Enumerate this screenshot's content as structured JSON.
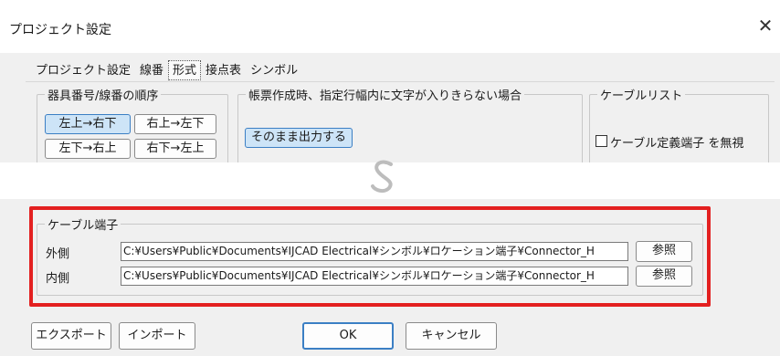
{
  "window": {
    "title": "プロジェクト設定",
    "close_glyph": "✕"
  },
  "tabs": [
    "プロジェクト設定",
    "線番",
    "形式",
    "接点表",
    "シンボル"
  ],
  "active_tab": "形式",
  "order_group": {
    "legend": "器具番号/線番の順序",
    "buttons": [
      "左上→右下",
      "右上→左下",
      "左下→右上",
      "右下→左上"
    ],
    "selected": "左上→右下"
  },
  "overflow_group": {
    "legend": "帳票作成時、指定行幅内に文字が入りきらない場合",
    "button": "そのまま出力する"
  },
  "cable_list_group": {
    "legend": "ケーブルリスト",
    "checkbox_label": "ケーブル定義端子 を無視",
    "checked": false
  },
  "cable_terminal_group": {
    "legend": "ケーブル端子",
    "outer_label": "外側",
    "outer_path": "C:¥Users¥Public¥Documents¥IJCAD Electrical¥シンボル¥ロケーション端子¥Connector_H",
    "inner_label": "内側",
    "inner_path": "C:¥Users¥Public¥Documents¥IJCAD Electrical¥シンボル¥ロケーション端子¥Connector_H",
    "browse_label": "参照"
  },
  "footer": {
    "export_label": "エクスポート",
    "import_label": "インポート",
    "ok_label": "OK",
    "cancel_label": "キャンセル"
  },
  "colors": {
    "highlight": "#e32020",
    "accent": "#3b7fc4"
  }
}
